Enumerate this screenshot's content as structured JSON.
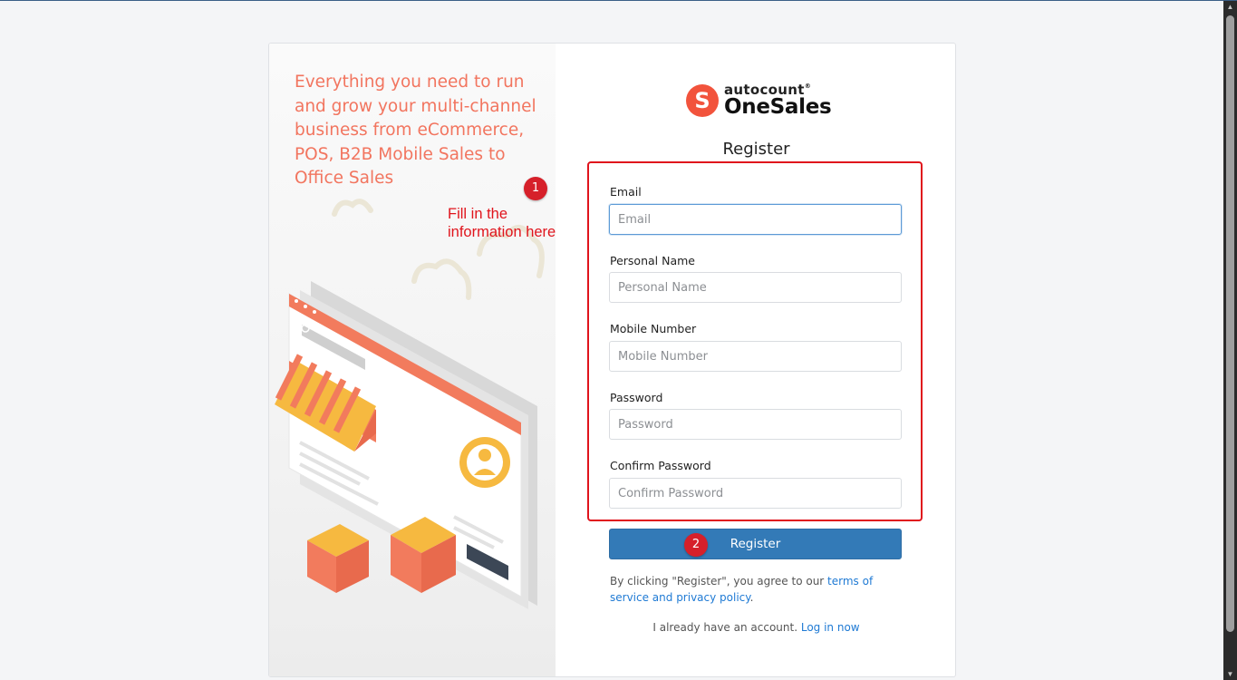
{
  "promo": {
    "tagline": "Everything you need to run and grow your multi-channel business from eCommerce, POS, B2B Mobile Sales to Office Sales"
  },
  "brand": {
    "logo_letter": "S",
    "logo_small": "autocount",
    "logo_small_mark": "®",
    "logo_big": "OneSales",
    "accent_color": "#f2533c"
  },
  "form": {
    "title": "Register",
    "fields": [
      {
        "label": "Email",
        "placeholder": "Email",
        "value": ""
      },
      {
        "label": "Personal Name",
        "placeholder": "Personal Name",
        "value": ""
      },
      {
        "label": "Mobile Number",
        "placeholder": "Mobile Number",
        "value": ""
      },
      {
        "label": "Password",
        "placeholder": "Password",
        "value": ""
      },
      {
        "label": "Confirm Password",
        "placeholder": "Confirm Password",
        "value": ""
      }
    ],
    "submit_label": "Register",
    "submit_color": "#337ab7",
    "agree_prefix": "By clicking \"Register\", you agree to our ",
    "agree_link": "terms of service and privacy policy",
    "agree_suffix": ".",
    "login_prefix": "I already have an account. ",
    "login_link": "Log in now"
  },
  "annotations": {
    "badge1": "1",
    "badge2": "2",
    "note_line1": "Fill in the",
    "note_line2": "information here",
    "color": "#e0141c"
  }
}
